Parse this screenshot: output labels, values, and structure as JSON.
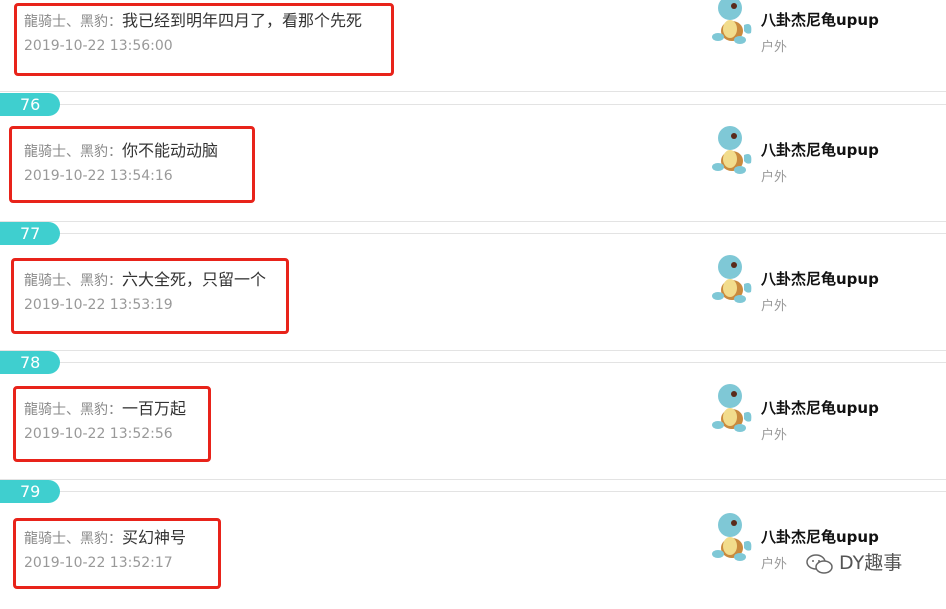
{
  "entries": [
    {
      "number": "",
      "names": "龍骑士、黑豹：",
      "text": "我已经到明年四月了，看那个先死",
      "time": "2019-10-22 13:56:00",
      "user": "八卦杰尼龟upup",
      "category": "户外"
    },
    {
      "number": "76",
      "names": "龍骑士、黑豹：",
      "text": "你不能动动脑",
      "time": "2019-10-22 13:54:16",
      "user": "八卦杰尼龟upup",
      "category": "户外"
    },
    {
      "number": "77",
      "names": "龍骑士、黑豹：",
      "text": "六大全死，只留一个",
      "time": "2019-10-22 13:53:19",
      "user": "八卦杰尼龟upup",
      "category": "户外"
    },
    {
      "number": "78",
      "names": "龍骑士、黑豹：",
      "text": "一百万起",
      "time": "2019-10-22 13:52:56",
      "user": "八卦杰尼龟upup",
      "category": "户外"
    },
    {
      "number": "79",
      "names": "龍骑士、黑豹：",
      "text": "买幻神号",
      "time": "2019-10-22 13:52:17",
      "user": "八卦杰尼龟upup",
      "category": "户外"
    }
  ],
  "watermark": "DY趣事",
  "colors": {
    "accent": "#3fcfcf",
    "highlight_box": "#e8231a"
  }
}
